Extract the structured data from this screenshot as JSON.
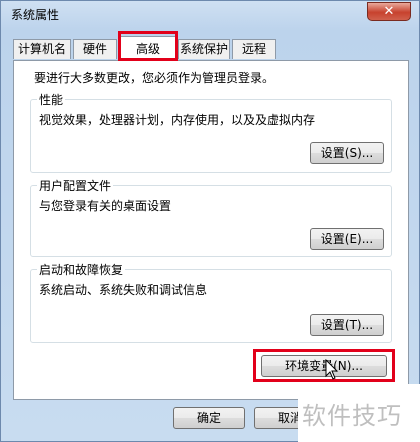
{
  "window": {
    "title": "系统属性",
    "close_symbol": "✕"
  },
  "tabs": [
    {
      "label": "计算机名"
    },
    {
      "label": "硬件"
    },
    {
      "label": "高级",
      "active": true
    },
    {
      "label": "系统保护"
    },
    {
      "label": "远程"
    }
  ],
  "notice": "要进行大多数更改，您必须作为管理员登录。",
  "groups": {
    "performance": {
      "title": "性能",
      "desc": "视觉效果，处理器计划，内存使用，以及及虚拟内存",
      "button": "设置(S)..."
    },
    "profile": {
      "title": "用户配置文件",
      "desc": "与您登录有关的桌面设置",
      "button": "设置(E)..."
    },
    "startup": {
      "title": "启动和故障恢复",
      "desc": "系统启动、系统失败和调试信息",
      "button": "设置(T)..."
    }
  },
  "env_button": "环境变量(N)...",
  "footer": {
    "ok": "确定",
    "cancel": "取消"
  },
  "watermark": "软件技巧"
}
